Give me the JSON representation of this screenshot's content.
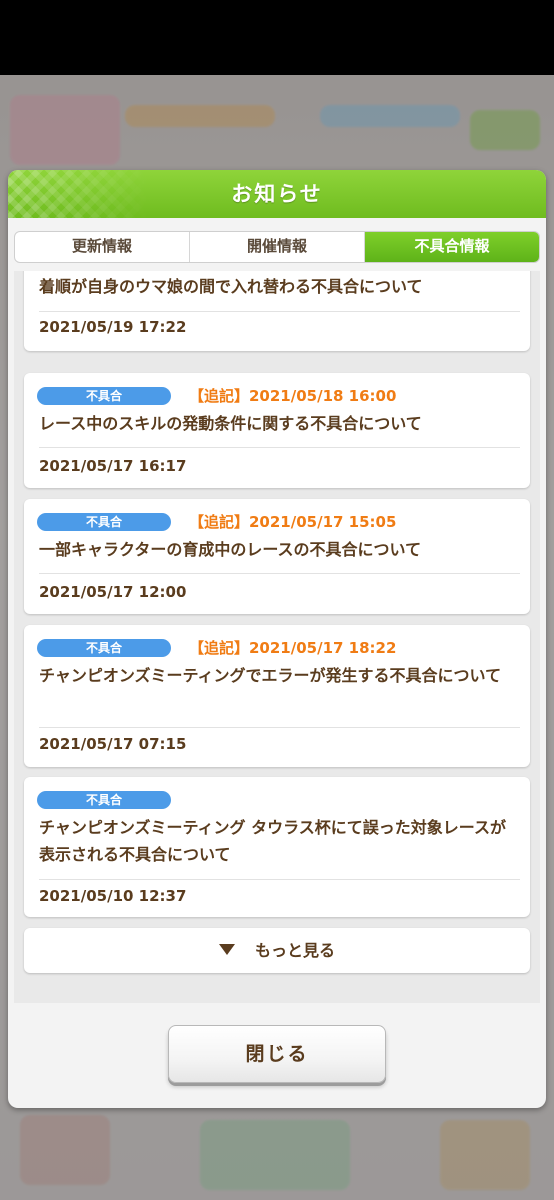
{
  "modal": {
    "title": "お知らせ"
  },
  "tabs": [
    {
      "label": "更新情報",
      "active": false
    },
    {
      "label": "開催情報",
      "active": false
    },
    {
      "label": "不具合情報",
      "active": true
    }
  ],
  "notices": [
    {
      "title": "着順が自身のウマ娘の間で入れ替わる不具合について",
      "date": "2021/05/19 17:22"
    },
    {
      "badge": "不具合",
      "note": "【追記】2021/05/18 16:00",
      "title": "レース中のスキルの発動条件に関する不具合について",
      "date": "2021/05/17 16:17"
    },
    {
      "badge": "不具合",
      "note": "【追記】2021/05/17 15:05",
      "title": "一部キャラクターの育成中のレースの不具合について",
      "date": "2021/05/17 12:00"
    },
    {
      "badge": "不具合",
      "note": "【追記】2021/05/17 18:22",
      "title": "チャンピオンズミーティングでエラーが発生する不具合について",
      "date": "2021/05/17 07:15"
    },
    {
      "badge": "不具合",
      "title": "チャンピオンズミーティング タウラス杯にて誤った対象レースが表示される不具合について",
      "date": "2021/05/10 12:37"
    }
  ],
  "more_label": "もっと見る",
  "close_label": "閉じる",
  "colors": {
    "header_green": "#6fbc1f",
    "badge_blue": "#4c9be8",
    "note_orange": "#f07c14",
    "text_brown": "#5a3c1e"
  }
}
